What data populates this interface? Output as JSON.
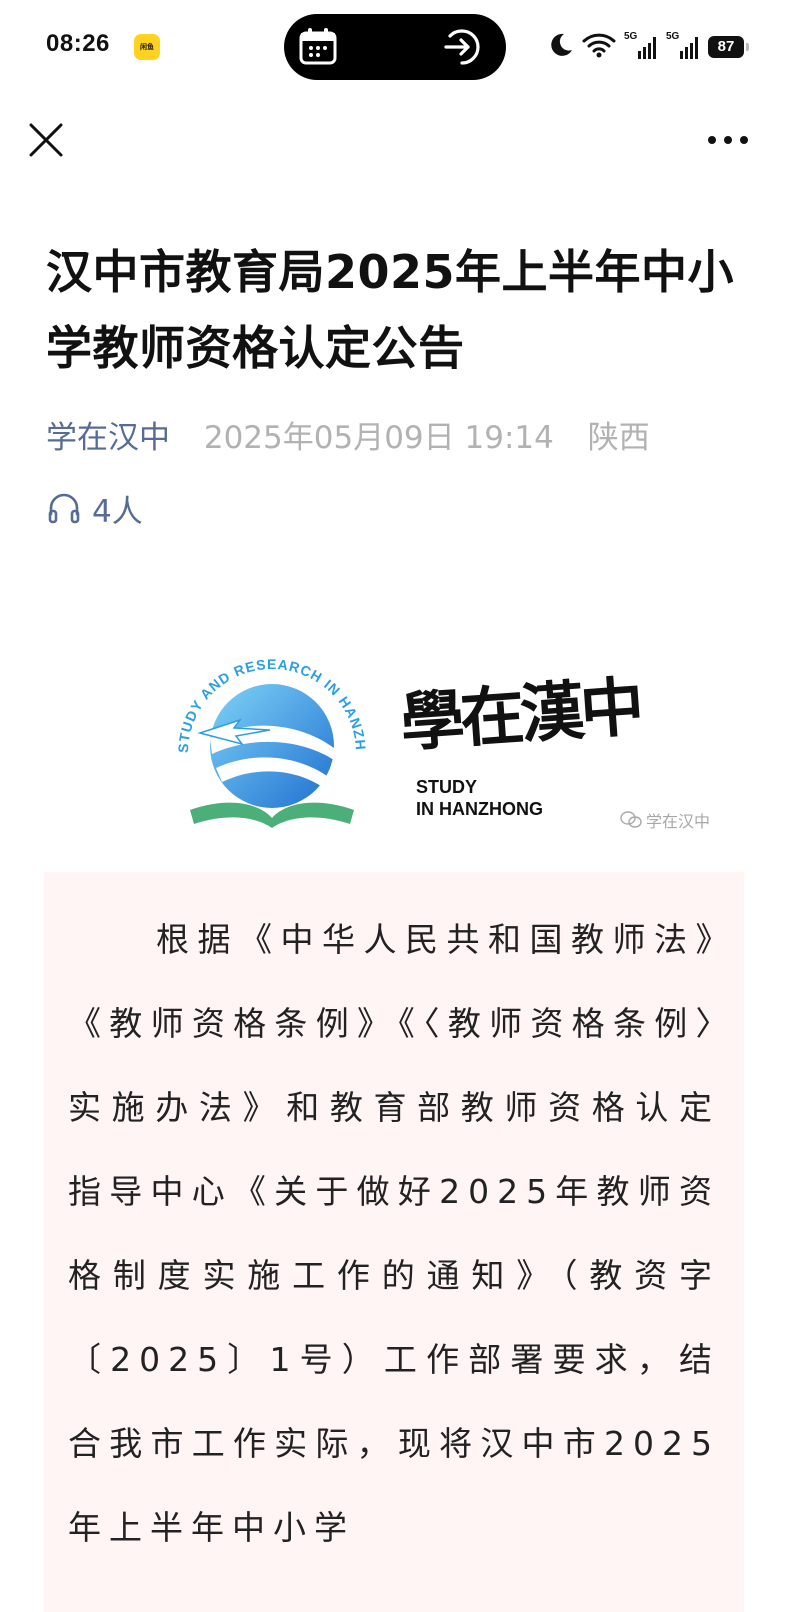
{
  "status_bar": {
    "time": "08:26",
    "app_badge_text": "闲鱼",
    "network_1": "5G",
    "network_2": "5G",
    "battery": "87",
    "icons": [
      "calendar-icon",
      "enter-arrow-icon",
      "moon-icon",
      "wifi-icon",
      "signal-icon",
      "battery-icon"
    ]
  },
  "nav": {
    "close_icon": "close-icon",
    "more_icon": "more-dots-icon"
  },
  "article": {
    "title": "汉中市教育局2025年上半年中小学教师资格认定公告",
    "account": "学在汉中",
    "date": "2025年05月09日 19:14",
    "region": "陕西",
    "listen_count": "4人",
    "logo": {
      "calligraphy": "學在漢中",
      "english_line1": "STUDY",
      "english_line2": "IN HANZHONG",
      "globe_text": "STUDY AND RESEARCH IN HANZHONG",
      "watermark": "学在汉中"
    },
    "body": "根据《中华人民共和国教师法》《教师资格条例》《〈教师资格条例〉实施办法》和教育部教师资格认定指导中心《关于做好2025年教师资格制度实施工作的通知》（教资字〔2025〕1号）工作部署要求，结合我市工作实际，现将汉中市2025年上半年中小学"
  },
  "colors": {
    "link_blue": "#576b95",
    "meta_gray": "#b2b2b2",
    "body_bg": "#fff5f4",
    "globe_blue": "#2b9fe0",
    "book_green": "#4caf7a"
  }
}
